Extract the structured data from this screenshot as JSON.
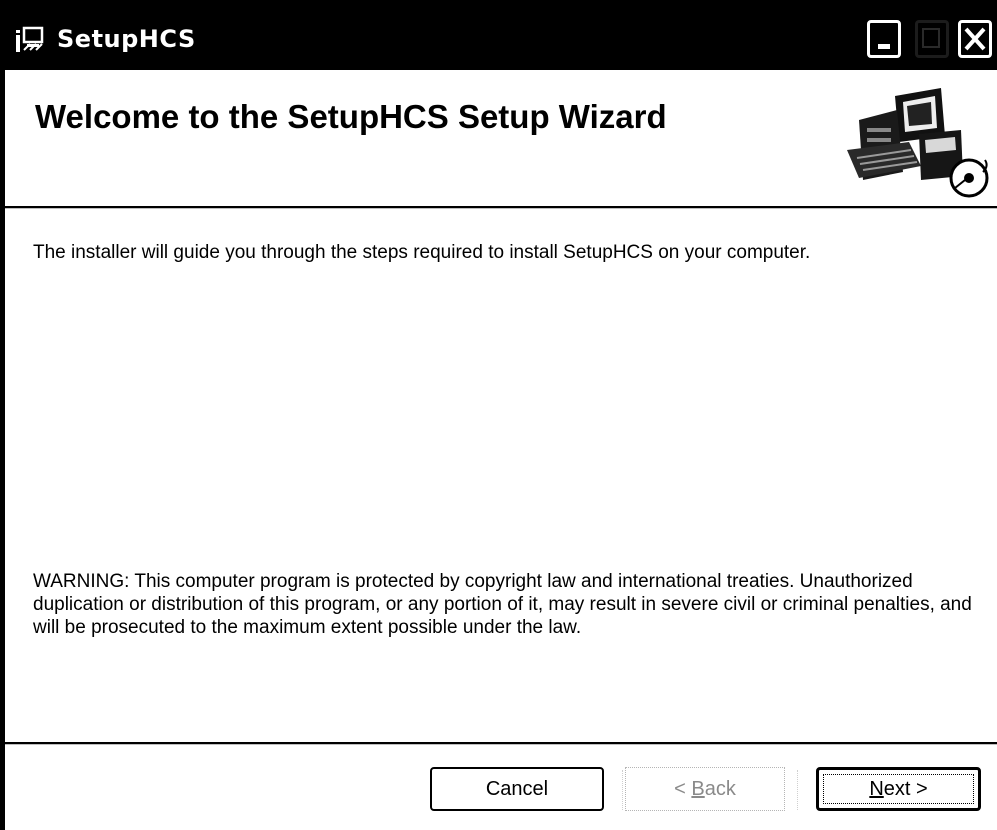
{
  "window": {
    "title": "SetupHCS",
    "app_icon": "installer-icon",
    "controls": [
      "minimize-icon",
      "maximize-icon",
      "close-icon"
    ]
  },
  "header": {
    "title": "Welcome to the SetupHCS Setup Wizard",
    "banner_icon": "computer-setup-icon"
  },
  "body": {
    "intro": "The installer will guide you through the steps required to install SetupHCS on your computer.",
    "warning": "WARNING: This computer program is protected by copyright law and international treaties. Unauthorized duplication or distribution of this program, or any portion of it, may result in severe civil or criminal penalties, and will be prosecuted to the maximum extent possible under the law."
  },
  "buttons": {
    "cancel": "Cancel",
    "back_prefix": "< ",
    "back_mnemonic": "B",
    "back_rest": "ack",
    "next_mnemonic": "N",
    "next_rest": "ext >"
  },
  "colors": {
    "titlebar": "#000000",
    "background": "#ffffff",
    "disabled_text": "#8a8a8a"
  }
}
